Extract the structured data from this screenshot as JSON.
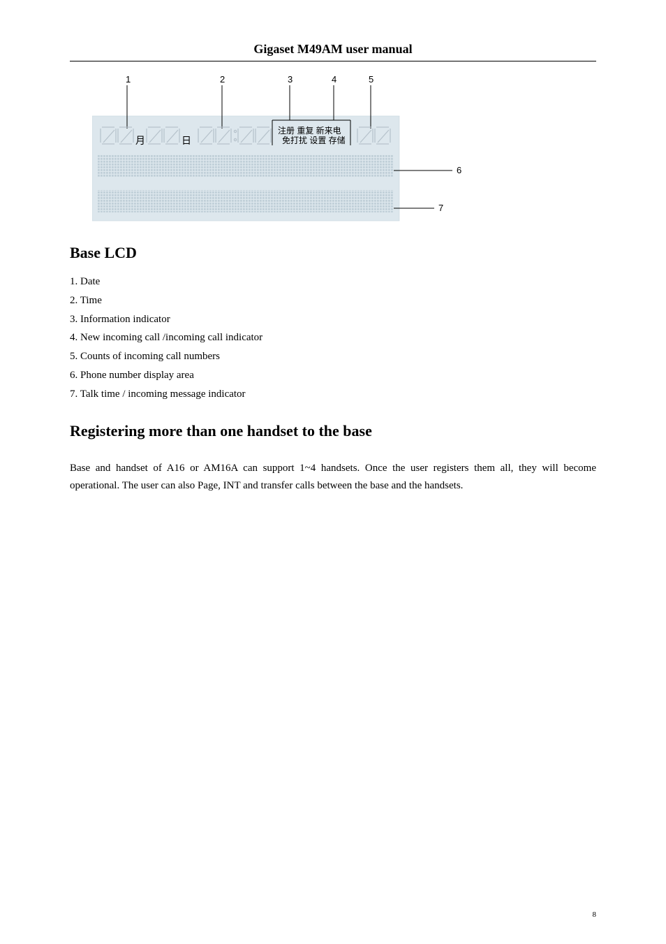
{
  "header": {
    "title": "Gigaset M49AM user manual"
  },
  "diagram": {
    "callouts": {
      "n1": "1",
      "n2": "2",
      "n3": "3",
      "n4": "4",
      "n5": "5",
      "n6": "6",
      "n7": "7"
    },
    "labels": {
      "month": "月",
      "day": "日",
      "row1": "注册 重复 新来电",
      "row2": "免打扰 设置 存储"
    }
  },
  "sections": {
    "baseLcd": {
      "heading": "Base LCD",
      "items": [
        {
          "num": "1.",
          "text": "Date"
        },
        {
          "num": "2.",
          "text": "Time"
        },
        {
          "num": "3.",
          "text": "Information indicator"
        },
        {
          "num": "4.",
          "text": "New incoming call /incoming call indicator"
        },
        {
          "num": "5.",
          "text": "Counts of incoming call numbers"
        },
        {
          "num": "6.",
          "text": "Phone number display area"
        },
        {
          "num": "7.",
          "text": "Talk time / incoming message indicator"
        }
      ]
    },
    "registering": {
      "heading": "Registering more than one handset to the base",
      "body": "Base and handset of A16 or AM16A can support 1~4 handsets. Once the user registers them all, they will become operational. The user can also Page, INT and transfer calls between the base and the handsets."
    }
  },
  "pageNumber": "8"
}
